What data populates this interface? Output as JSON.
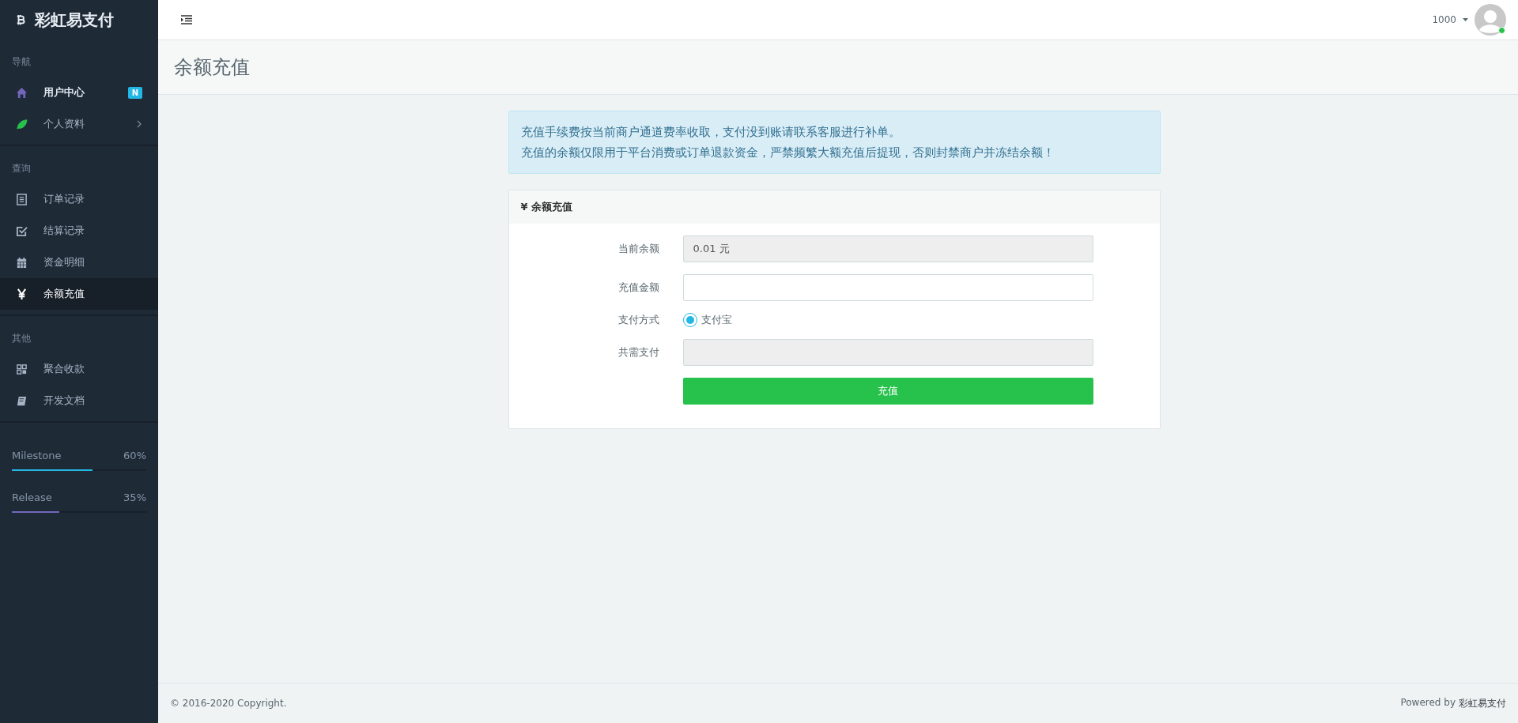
{
  "sidebar": {
    "brand": "彩虹易支付",
    "sections": [
      {
        "heading": "导航",
        "items": [
          {
            "label": "用户中心",
            "selected": false,
            "emphasized": true,
            "badge": "N",
            "expandable": false
          },
          {
            "label": "个人资料",
            "selected": false,
            "emphasized": false,
            "expandable": true
          }
        ]
      },
      {
        "heading": "查询",
        "items": [
          {
            "label": "订单记录",
            "selected": false,
            "emphasized": false,
            "expandable": false
          },
          {
            "label": "结算记录",
            "selected": false,
            "emphasized": false,
            "expandable": false
          },
          {
            "label": "资金明细",
            "selected": false,
            "emphasized": false,
            "expandable": false
          },
          {
            "label": "余额充值",
            "selected": true,
            "emphasized": false,
            "expandable": false
          }
        ]
      },
      {
        "heading": "其他",
        "items": [
          {
            "label": "聚合收款",
            "selected": false,
            "emphasized": false,
            "expandable": false
          },
          {
            "label": "开发文档",
            "selected": false,
            "emphasized": false,
            "expandable": false
          }
        ]
      }
    ],
    "progress": [
      {
        "label": "Milestone",
        "reading": "60%",
        "level": 0.6,
        "color": "#23b7e5"
      },
      {
        "label": "Release",
        "reading": "35%",
        "level": 0.35,
        "color": "#7266ba"
      }
    ]
  },
  "topbar": {
    "user": "1000",
    "online": true
  },
  "page_title": "余额充值",
  "notice": [
    "充值手续费按当前商户通道费率收取，支付没到账请联系客服进行补单。",
    "充值的余额仅限用于平台消费或订单退款资金，严禁频繁大额充值后提现，否则封禁商户并冻结余额！"
  ],
  "panel": {
    "title": "¥ 余额充值",
    "fields": [
      {
        "kind": "readonly",
        "label": "当前余额",
        "value": "0.01 元"
      },
      {
        "kind": "input",
        "label": "充值金额"
      },
      {
        "kind": "radio",
        "label": "支付方式",
        "options": [
          {
            "label": "支付宝",
            "selected": true
          }
        ]
      },
      {
        "kind": "readonly",
        "label": "共需支付"
      }
    ],
    "submit": "充值"
  },
  "footer": {
    "copyright": "© 2016-2020 Copyright.",
    "powered_by": "Powered by",
    "brand_link": "彩虹易支付"
  }
}
